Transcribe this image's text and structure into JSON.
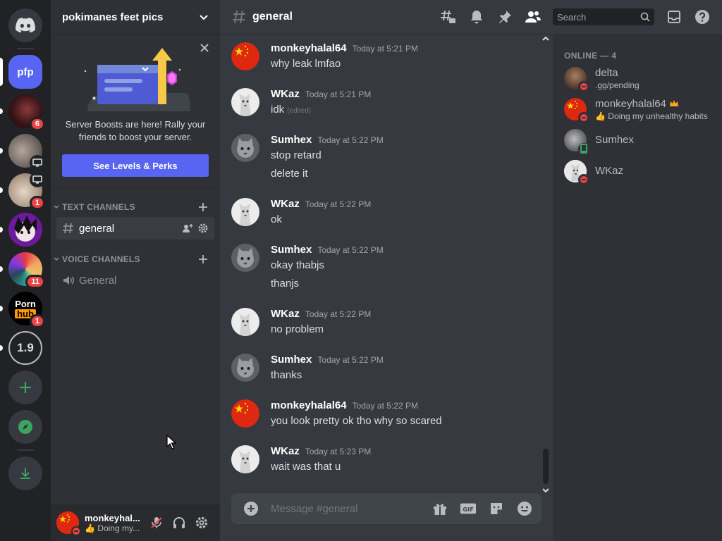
{
  "server_rail": {
    "servers": [
      {
        "name": "pfp",
        "initials": "pfp"
      },
      {
        "name": "server-2",
        "badge": "6"
      },
      {
        "name": "server-3",
        "voice": true
      },
      {
        "name": "server-4",
        "voice": true,
        "badge": "1"
      },
      {
        "name": "server-5"
      },
      {
        "name": "server-6",
        "badge": "11"
      },
      {
        "name": "server-7",
        "logo_top": "Porn",
        "logo_bottom": "hub",
        "badge": "1"
      },
      {
        "name": "server-8",
        "logo": "1.9"
      }
    ]
  },
  "guild": {
    "name": "pokimanes feet pics"
  },
  "boost_banner": {
    "text": "Server Boosts are here! Rally your friends to boost your server.",
    "button": "See Levels & Perks"
  },
  "channels": {
    "text_category": "TEXT CHANNELS",
    "voice_category": "VOICE CHANNELS",
    "text_channel": "general",
    "voice_channel": "General"
  },
  "user_panel": {
    "name": "monkeyhal...",
    "status": "👍 Doing my..."
  },
  "header": {
    "channel": "general",
    "search_placeholder": "Search"
  },
  "messages": [
    {
      "author": "monkeyhalal64",
      "time": "Today at 5:21 PM",
      "lines": [
        "why leak lmfao"
      ],
      "avatar": "flag"
    },
    {
      "author": "WKaz",
      "time": "Today at 5:21 PM",
      "lines": [
        "idk"
      ],
      "edited": "(edited)",
      "avatar": "dog"
    },
    {
      "author": "Sumhex",
      "time": "Today at 5:22 PM",
      "lines": [
        "stop retard",
        "delete it"
      ],
      "avatar": "cat"
    },
    {
      "author": "WKaz",
      "time": "Today at 5:22 PM",
      "lines": [
        "ok"
      ],
      "avatar": "dog"
    },
    {
      "author": "Sumhex",
      "time": "Today at 5:22 PM",
      "lines": [
        "okay thabjs",
        "thanjs"
      ],
      "avatar": "cat"
    },
    {
      "author": "WKaz",
      "time": "Today at 5:22 PM",
      "lines": [
        "no problem"
      ],
      "avatar": "dog"
    },
    {
      "author": "Sumhex",
      "time": "Today at 5:22 PM",
      "lines": [
        "thanks"
      ],
      "avatar": "cat"
    },
    {
      "author": "monkeyhalal64",
      "time": "Today at 5:22 PM",
      "lines": [
        "you look pretty ok tho why so scared"
      ],
      "avatar": "flag"
    },
    {
      "author": "WKaz",
      "time": "Today at 5:23 PM",
      "lines": [
        "wait was that u"
      ],
      "avatar": "dog"
    }
  ],
  "composer": {
    "placeholder": "Message #general"
  },
  "members": {
    "heading": "ONLINE — 4",
    "list": [
      {
        "name": "delta",
        "sub": ".gg/pending",
        "status": "dnd"
      },
      {
        "name": "monkeyhalal64",
        "sub": "👍 Doing my unhealthy habits",
        "status": "dnd",
        "crown": true
      },
      {
        "name": "Sumhex",
        "sub": "",
        "status": "mobile"
      },
      {
        "name": "WKaz",
        "sub": "",
        "status": "dnd"
      }
    ]
  },
  "colors": {
    "blurple": "#5865f2",
    "dnd": "#ed4245",
    "online": "#3ba55d",
    "boost_pink": "#ff73fa",
    "crown": "#faa81a"
  }
}
